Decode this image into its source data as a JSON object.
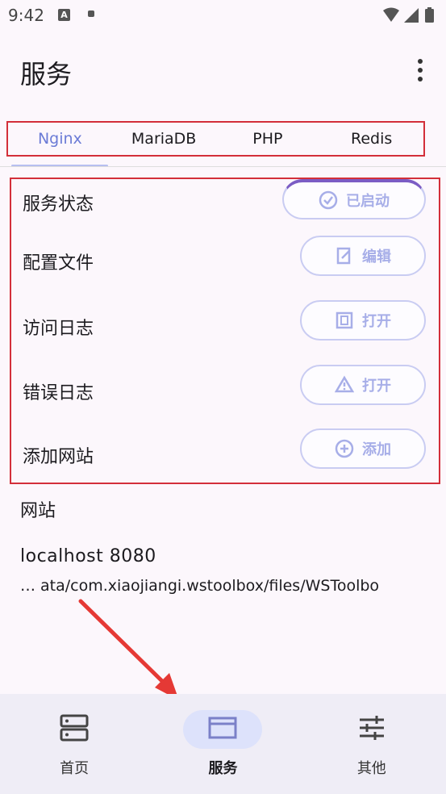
{
  "status_bar": {
    "time": "9:42",
    "notif_icon_letter": "A"
  },
  "app_bar": {
    "title": "服务"
  },
  "tabs": [
    {
      "label": "Nginx",
      "active": true
    },
    {
      "label": "MariaDB",
      "active": false
    },
    {
      "label": "PHP",
      "active": false
    },
    {
      "label": "Redis",
      "active": false
    }
  ],
  "services": {
    "status": {
      "label": "服务状态",
      "button": "已启动",
      "icon": "check-circle-icon"
    },
    "config": {
      "label": "配置文件",
      "button": "编辑",
      "icon": "edit-file-icon"
    },
    "access_log": {
      "label": "访问日志",
      "button": "打开",
      "icon": "log-file-icon"
    },
    "error_log": {
      "label": "错误日志",
      "button": "打开",
      "icon": "warning-icon"
    },
    "add_site": {
      "label": "添加网站",
      "button": "添加",
      "icon": "add-circle-icon"
    }
  },
  "sites": {
    "section_label": "网站",
    "items": [
      {
        "name": "localhost  8080",
        "path": "… ata/com.xiaojiangi.wstoolbox/files/WSToolbo"
      }
    ]
  },
  "bottom_nav": [
    {
      "label": "首页",
      "icon": "server-icon",
      "active": false
    },
    {
      "label": "服务",
      "icon": "window-icon",
      "active": true
    },
    {
      "label": "其他",
      "icon": "sliders-icon",
      "active": false
    }
  ],
  "colors": {
    "highlight_box": "#d32f3a",
    "accent": "#6b7bd6",
    "annotation_arrow": "#e53935"
  }
}
